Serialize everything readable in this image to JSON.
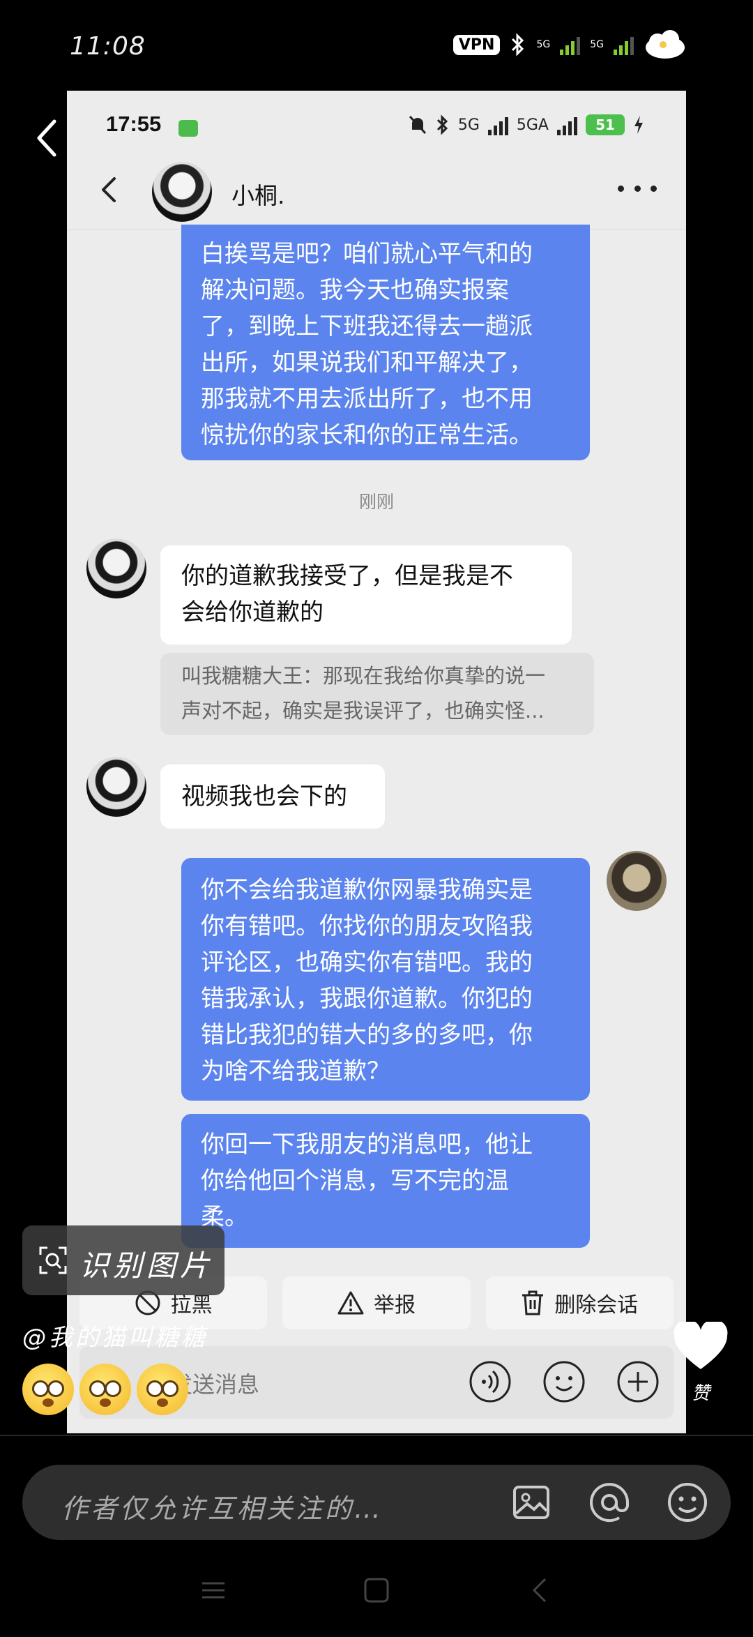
{
  "outer_status": {
    "time": "11:08",
    "vpn": "VPN",
    "network_1": "5G",
    "network_2": "5G"
  },
  "inner_status": {
    "time": "17:55",
    "network_1": "5G",
    "network_2": "5GA",
    "battery": "51"
  },
  "chat": {
    "contact_name": "小桐.",
    "messages": [
      {
        "side": "out",
        "text": "白挨骂是吧？咱们就心平气和的\n解决问题。我今天也确实报案\n了，到晚上下班我还得去一趟派\n出所，如果说我们和平解决了，\n那我就不用去派出所了，也不用\n惊扰你的家长和你的正常生活。"
      },
      {
        "side": "time",
        "text": "刚刚"
      },
      {
        "side": "in",
        "text": "你的道歉我接受了，但是我是不\n会给你道歉的"
      },
      {
        "side": "quote",
        "text": "叫我糖糖大王：那现在我给你真挚的说一\n声对不起，确实是我误评了，也确实怪..."
      },
      {
        "side": "in",
        "text": "视频我也会下的"
      },
      {
        "side": "out",
        "text": "你不会给我道歉你网暴我确实是\n你有错吧。你找你的朋友攻陷我\n评论区，也确实你有错吧。我的\n错我承认，我跟你道歉。你犯的\n错比我犯的错大的多的多吧，你\n为啥不给我道歉？"
      },
      {
        "side": "out",
        "text": "你回一下我朋友的消息吧，他让\n你给他回个消息，写不完的温\n柔。"
      }
    ]
  },
  "actions": {
    "block": "拉黑",
    "report": "举报",
    "delete": "删除会话"
  },
  "input": {
    "placeholder": "发送消息"
  },
  "overlay": {
    "recognize_label": "识别图片",
    "author": "@我的猫叫糖糖",
    "like_label": "赞"
  },
  "comment": {
    "placeholder": "作者仅允许互相关注的…"
  },
  "colors": {
    "outgoing_bubble": "#5b84ee",
    "incoming_bubble": "#ffffff",
    "battery": "#4cbf4c"
  },
  "icons": [
    "back-icon",
    "more-icon",
    "block-icon",
    "warning-icon",
    "trash-icon",
    "voice-icon",
    "emoji-icon",
    "plus-icon",
    "scan-icon",
    "heart-icon",
    "image-icon",
    "at-icon",
    "smile-icon"
  ]
}
